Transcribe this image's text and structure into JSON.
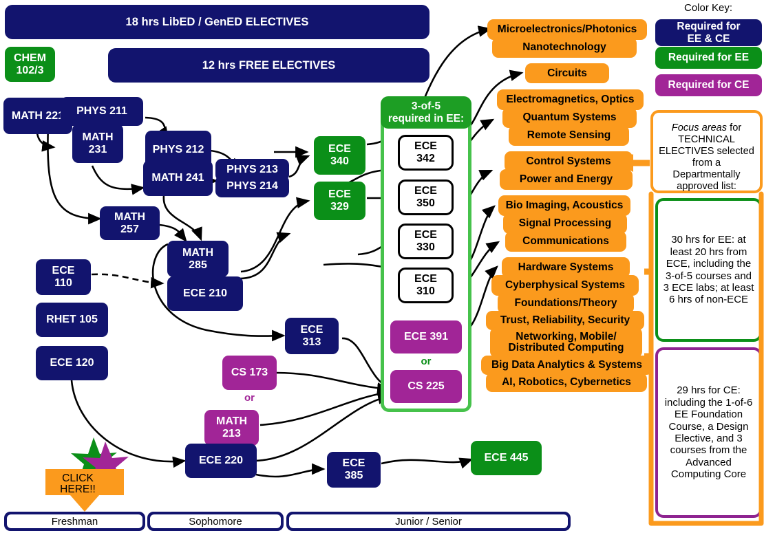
{
  "banners": [
    {
      "id": "libed",
      "label": "18 hrs LibED / GenED ELECTIVES"
    },
    {
      "id": "free",
      "label": "12 hrs FREE ELECTIVES"
    }
  ],
  "courses": [
    {
      "id": "chem1023",
      "label": "CHEM\n102/3",
      "color": "green"
    },
    {
      "id": "math221",
      "label": "MATH 221",
      "color": "navy"
    },
    {
      "id": "phys211",
      "label": "PHYS 211",
      "color": "navy"
    },
    {
      "id": "math231",
      "label": "MATH\n231",
      "color": "navy"
    },
    {
      "id": "phys212",
      "label": "PHYS 212",
      "color": "navy"
    },
    {
      "id": "math241",
      "label": "MATH 241",
      "color": "navy"
    },
    {
      "id": "phys213",
      "label": "PHYS 213",
      "color": "navy"
    },
    {
      "id": "phys214",
      "label": "PHYS 214",
      "color": "navy"
    },
    {
      "id": "math257",
      "label": "MATH\n257",
      "color": "navy"
    },
    {
      "id": "math285",
      "label": "MATH\n285",
      "color": "navy"
    },
    {
      "id": "ece110",
      "label": "ECE\n110",
      "color": "navy"
    },
    {
      "id": "ece210",
      "label": "ECE 210",
      "color": "navy"
    },
    {
      "id": "rhet105",
      "label": "RHET 105",
      "color": "navy"
    },
    {
      "id": "ece120",
      "label": "ECE 120",
      "color": "navy"
    },
    {
      "id": "ece313",
      "label": "ECE\n313",
      "color": "navy"
    },
    {
      "id": "cs173",
      "label": "CS 173",
      "color": "purple"
    },
    {
      "id": "math213",
      "label": "MATH\n213",
      "color": "purple"
    },
    {
      "id": "ece220",
      "label": "ECE 220",
      "color": "navy"
    },
    {
      "id": "ece385",
      "label": "ECE\n385",
      "color": "navy"
    },
    {
      "id": "ece445",
      "label": "ECE 445",
      "color": "green"
    },
    {
      "id": "ece340",
      "label": "ECE\n340",
      "color": "green"
    },
    {
      "id": "ece329",
      "label": "ECE\n329",
      "color": "green"
    },
    {
      "id": "ece342",
      "label": "ECE\n342",
      "color": "white"
    },
    {
      "id": "ece350",
      "label": "ECE\n350",
      "color": "white"
    },
    {
      "id": "ece330",
      "label": "ECE\n330",
      "color": "white"
    },
    {
      "id": "ece310",
      "label": "ECE\n310",
      "color": "white"
    },
    {
      "id": "ece391",
      "label": "ECE 391",
      "color": "purple"
    },
    {
      "id": "cs225",
      "label": "CS 225",
      "color": "purple"
    }
  ],
  "group": {
    "header": "3-of-5\nrequired in EE:",
    "or_label": "or"
  },
  "cs_math_or_label": "or",
  "focus_areas": [
    {
      "id": "fa-micro",
      "label": "Microelectronics/Photonics"
    },
    {
      "id": "fa-nano",
      "label": "Nanotechnology"
    },
    {
      "id": "fa-circ",
      "label": "Circuits"
    },
    {
      "id": "fa-em",
      "label": "Electromagnetics, Optics"
    },
    {
      "id": "fa-quantum",
      "label": "Quantum Systems"
    },
    {
      "id": "fa-remote",
      "label": "Remote Sensing"
    },
    {
      "id": "fa-control",
      "label": "Control Systems"
    },
    {
      "id": "fa-power",
      "label": "Power and Energy"
    },
    {
      "id": "fa-bio",
      "label": "Bio Imaging, Acoustics"
    },
    {
      "id": "fa-signal",
      "label": "Signal Processing"
    },
    {
      "id": "fa-comm",
      "label": "Communications"
    },
    {
      "id": "fa-hw",
      "label": "Hardware Systems"
    },
    {
      "id": "fa-cyber",
      "label": "Cyberphysical Systems"
    },
    {
      "id": "fa-found",
      "label": "Foundations/Theory"
    },
    {
      "id": "fa-trust",
      "label": "Trust, Reliability, Security"
    },
    {
      "id": "fa-net",
      "label": "Networking, Mobile/\nDistributed Computing"
    },
    {
      "id": "fa-bigdata",
      "label": "Big Data Analytics & Systems"
    },
    {
      "id": "fa-ai",
      "label": "AI, Robotics, Cybernetics"
    }
  ],
  "color_key": {
    "title": "Color Key:",
    "entries": [
      {
        "id": "key-navy",
        "label": "Required for\nEE & CE",
        "color": "#12146e"
      },
      {
        "id": "key-green",
        "label": "Required for EE",
        "color": "#0b8f18"
      },
      {
        "id": "key-purple",
        "label": "Required for CE",
        "color": "#a12597"
      }
    ]
  },
  "side_panels": {
    "focus_note_italic": "Focus areas",
    "focus_note_rest": " for TECHNICAL ELECTIVES selected from a Departmentally approved list:",
    "ee_note": "30 hrs for EE: at least 20 hrs from ECE, including the 3-of-5 courses and 3 ECE labs; at least 6 hrs of non-ECE",
    "ce_note": "29 hrs for CE: including the 1-of-6 EE Foundation Course, a Design Elective, and 3 courses from the Advanced Computing Core"
  },
  "click_here": {
    "label": "CLICK\nHERE!!"
  },
  "year_bar": [
    {
      "id": "year-freshman",
      "label": "Freshman"
    },
    {
      "id": "year-sophomore",
      "label": "Sophomore"
    },
    {
      "id": "year-junsen",
      "label": "Junior / Senior"
    }
  ],
  "colors": {
    "navy": "#12146e",
    "green": "#0b8f18",
    "purple": "#a12597",
    "orange": "#fb9a1d",
    "group_border": "#46c24b",
    "group_header": "#1d9e24"
  }
}
